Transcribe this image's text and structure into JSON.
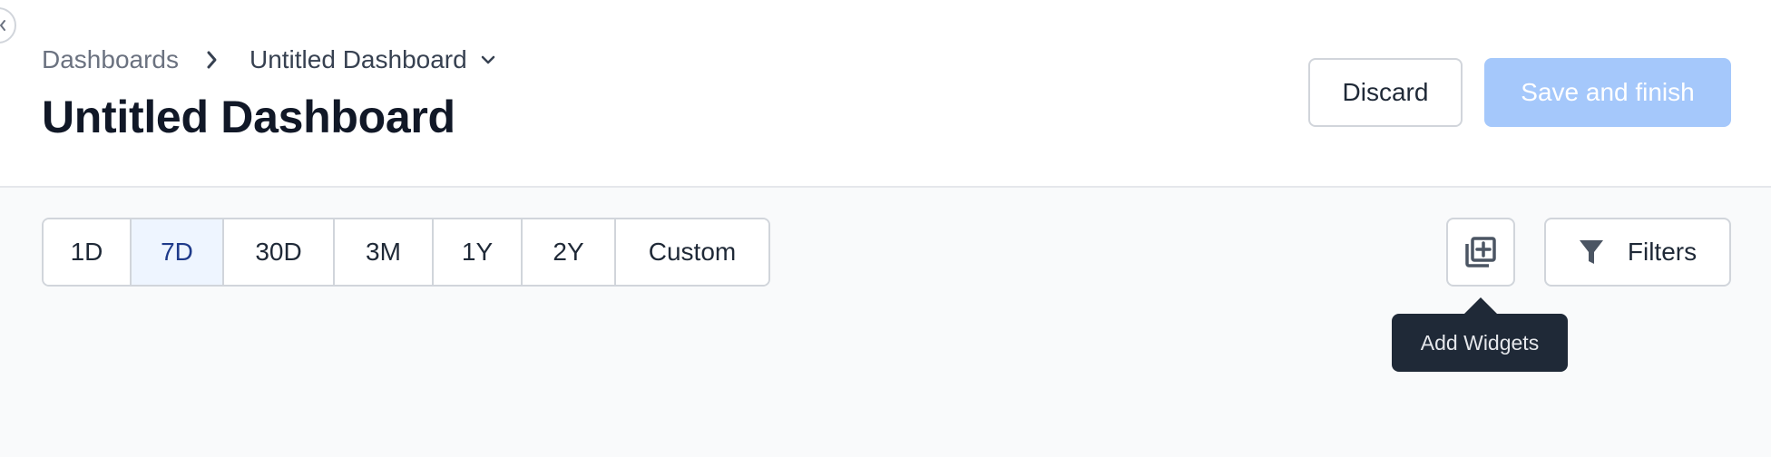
{
  "breadcrumb": {
    "root": "Dashboards",
    "current": "Untitled Dashboard"
  },
  "page": {
    "title": "Untitled Dashboard"
  },
  "actions": {
    "discard_label": "Discard",
    "save_label": "Save and finish"
  },
  "time_ranges": {
    "items": [
      "1D",
      "7D",
      "30D",
      "3M",
      "1Y",
      "2Y",
      "Custom"
    ],
    "selected": "7D"
  },
  "toolbar": {
    "filters_label": "Filters",
    "add_widgets_tooltip": "Add Widgets"
  },
  "icons": {
    "collapse": "chevron-left-icon",
    "breadcrumb_separator": "chevron-right-icon",
    "dropdown": "chevron-down-icon",
    "add_widgets": "library-add-icon",
    "filters": "funnel-icon"
  },
  "colors": {
    "save_button_disabled": "#a5c8fb",
    "selected_range_bg": "#eef5ff",
    "tooltip_bg": "#1f2937"
  }
}
